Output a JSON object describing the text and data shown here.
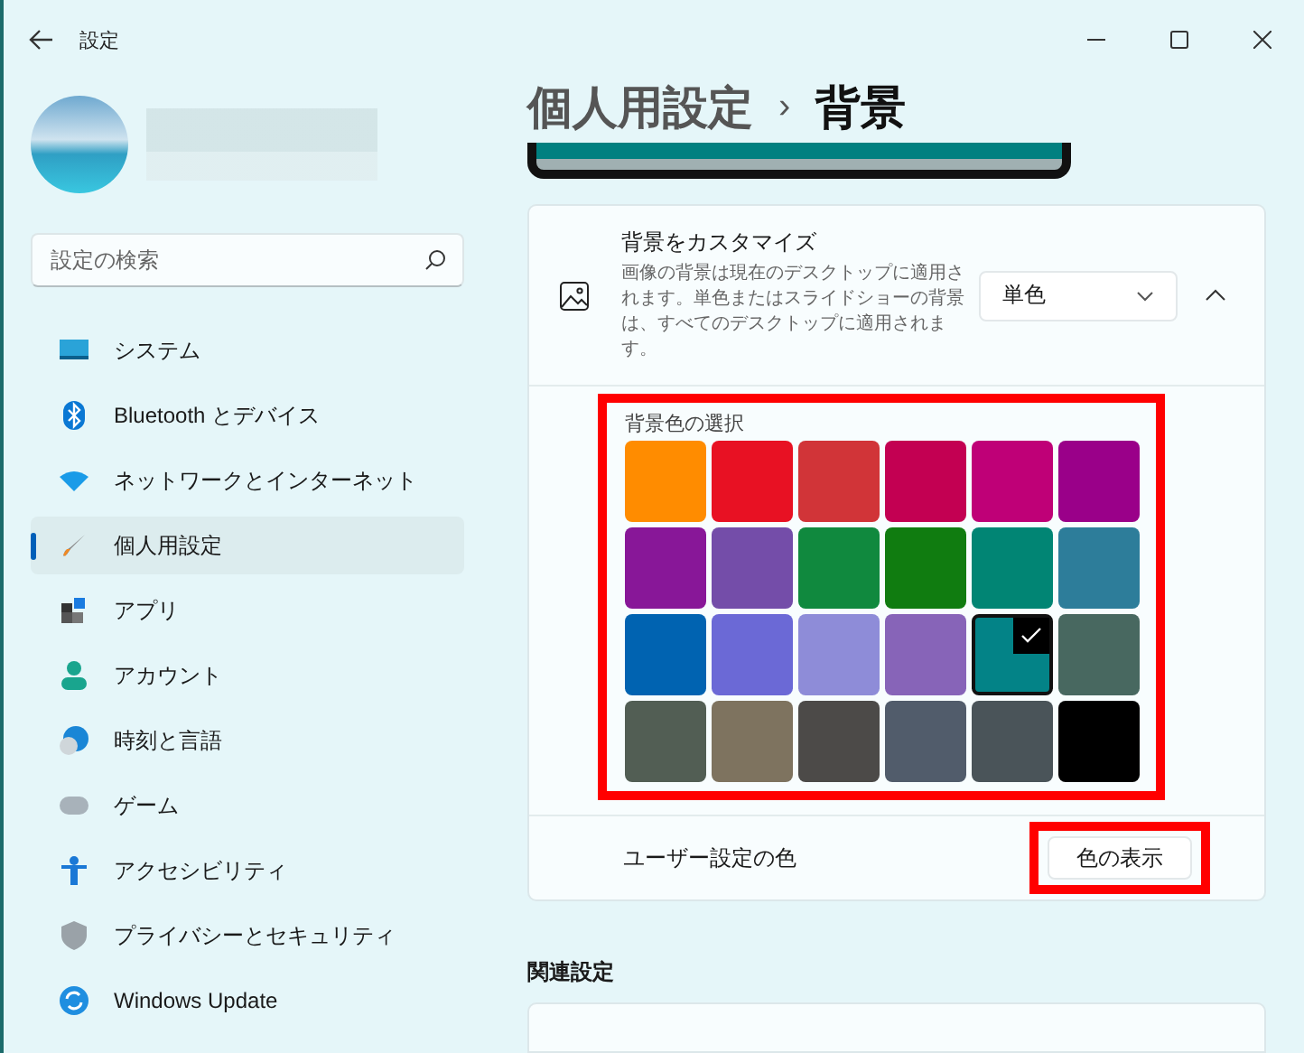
{
  "window": {
    "title": "設定"
  },
  "search": {
    "placeholder": "設定の検索"
  },
  "nav": [
    {
      "label": "システム",
      "selected": false
    },
    {
      "label": "Bluetooth とデバイス",
      "selected": false
    },
    {
      "label": "ネットワークとインターネット",
      "selected": false
    },
    {
      "label": "個人用設定",
      "selected": true
    },
    {
      "label": "アプリ",
      "selected": false
    },
    {
      "label": "アカウント",
      "selected": false
    },
    {
      "label": "時刻と言語",
      "selected": false
    },
    {
      "label": "ゲーム",
      "selected": false
    },
    {
      "label": "アクセシビリティ",
      "selected": false
    },
    {
      "label": "プライバシーとセキュリティ",
      "selected": false
    },
    {
      "label": "Windows Update",
      "selected": false
    }
  ],
  "breadcrumb": {
    "parent": "個人用設定",
    "separator": "›",
    "current": "背景"
  },
  "background_card": {
    "title": "背景をカスタマイズ",
    "description": "画像の背景は現在のデスクトップに適用されます。単色またはスライドショーの背景は、すべてのデスクトップに適用されます。",
    "dropdown_value": "単色",
    "expanded": true
  },
  "color_picker": {
    "label": "背景色の選択",
    "swatches": [
      {
        "color": "#ff8c00",
        "selected": false
      },
      {
        "color": "#e81123",
        "selected": false
      },
      {
        "color": "#d13438",
        "selected": false
      },
      {
        "color": "#c30052",
        "selected": false
      },
      {
        "color": "#bf0077",
        "selected": false
      },
      {
        "color": "#9a0089",
        "selected": false
      },
      {
        "color": "#881798",
        "selected": false
      },
      {
        "color": "#744da9",
        "selected": false
      },
      {
        "color": "#10893e",
        "selected": false
      },
      {
        "color": "#107c10",
        "selected": false
      },
      {
        "color": "#018574",
        "selected": false
      },
      {
        "color": "#2d7d9a",
        "selected": false
      },
      {
        "color": "#0063b1",
        "selected": false
      },
      {
        "color": "#6b69d6",
        "selected": false
      },
      {
        "color": "#8e8cd8",
        "selected": false
      },
      {
        "color": "#8764b8",
        "selected": false
      },
      {
        "color": "#038387",
        "selected": true
      },
      {
        "color": "#486860",
        "selected": false
      },
      {
        "color": "#525e54",
        "selected": false
      },
      {
        "color": "#7e735f",
        "selected": false
      },
      {
        "color": "#4c4a48",
        "selected": false
      },
      {
        "color": "#515c6b",
        "selected": false
      },
      {
        "color": "#4a5459",
        "selected": false
      },
      {
        "color": "#000000",
        "selected": false
      }
    ]
  },
  "custom_color": {
    "label": "ユーザー設定の色",
    "button": "色の表示"
  },
  "related": {
    "heading": "関連設定"
  }
}
